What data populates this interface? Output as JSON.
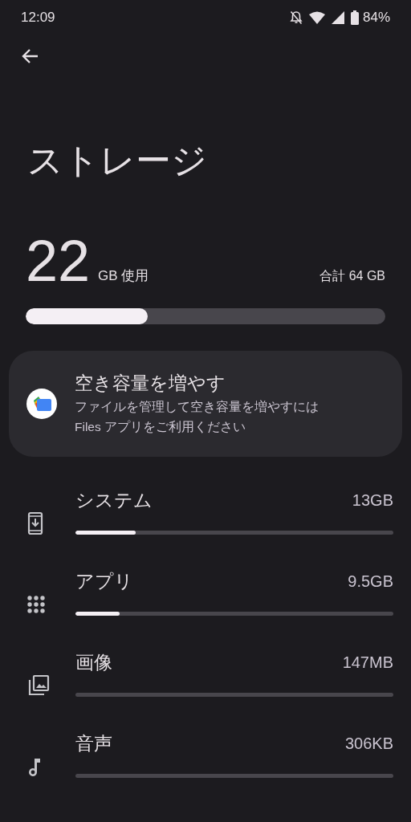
{
  "status_bar": {
    "time": "12:09",
    "battery": "84%"
  },
  "title": "ストレージ",
  "usage": {
    "amount": "22",
    "unit": "GB 使用",
    "total": "合計 64 GB",
    "level": 0.34
  },
  "card": {
    "title": "空き容量を増やす",
    "description": "ファイルを管理して空き容量を増やすには Files アプリをご利用ください"
  },
  "categories": [
    {
      "kind": "system",
      "label": "システム",
      "size": "13GB",
      "level": 0.19
    },
    {
      "kind": "apps",
      "label": "アプリ",
      "size": "9.5GB",
      "level": 0.14
    },
    {
      "kind": "images",
      "label": "画像",
      "size": "147MB",
      "level": 0
    },
    {
      "kind": "audio",
      "label": "音声",
      "size": "306KB",
      "level": 0
    }
  ]
}
